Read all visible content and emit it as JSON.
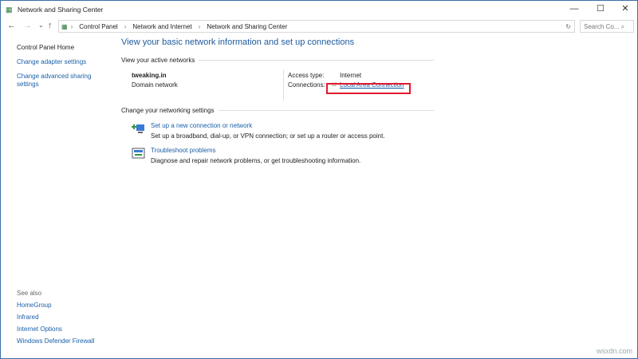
{
  "window": {
    "title": "Network and Sharing Center",
    "min": "—",
    "max": "☐",
    "close": "✕"
  },
  "nav": {
    "back": "←",
    "forward": "→",
    "recent": "⌄",
    "up": "↑",
    "breadcrumb": [
      "Control Panel",
      "Network and Internet",
      "Network and Sharing Center"
    ],
    "sep": "›",
    "refresh": "↻",
    "search_placeholder": "Search Co... ⌕"
  },
  "sidebar": {
    "items": [
      "Control Panel Home",
      "Change adapter settings",
      "Change advanced sharing settings"
    ],
    "see_also_label": "See also",
    "see_also": [
      "HomeGroup",
      "Infrared",
      "Internet Options",
      "Windows Defender Firewall"
    ]
  },
  "main": {
    "title": "View your basic network information and set up connections",
    "active_label": "View your active networks",
    "network_name": "tweaking.in",
    "network_type": "Domain network",
    "access_label": "Access type:",
    "access_value": "Internet",
    "conn_label": "Connections:",
    "conn_value": "Local Area Connection",
    "change_label": "Change your networking settings",
    "tasks": [
      {
        "title": "Set up a new connection or network",
        "desc": "Set up a broadband, dial-up, or VPN connection; or set up a router or access point."
      },
      {
        "title": "Troubleshoot problems",
        "desc": "Diagnose and repair network problems, or get troubleshooting information."
      }
    ]
  },
  "watermark": "wsxdn.com"
}
